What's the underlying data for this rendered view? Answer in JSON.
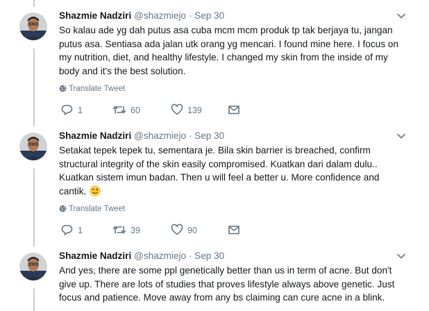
{
  "tweets": [
    {
      "name": "Shazmie Nadziri",
      "handle": "@shazmiejo",
      "separator": "·",
      "time": "Sep 30",
      "text": "So kalau ade yg dah putus asa cuba mcm mcm produk tp tak berjaya tu, jangan\nputus asa. Sentiasa ada jalan utk orang yg mencari. I found mine here. I focus on\nmy nutrition, diet, and healthy lifestyle. I changed my skin from the inside of my\nbody and it's the best solution.",
      "translate": "Translate Tweet",
      "replies": "1",
      "retweets": "60",
      "likes": "139"
    },
    {
      "name": "Shazmie Nadziri",
      "handle": "@shazmiejo",
      "separator": "·",
      "time": "Sep 30",
      "text": "Setakat tepek tepek tu, sementara je. Bila skin barrier is breached, confirm\nstructural integrity of the skin easily compromised. Kuatkan dari dalam dulu..\nKuatkan sistem imun badan. Then u will feel a better u. More confidence and\ncantik.",
      "emoji": "winking-face-emoji",
      "translate": "Translate Tweet",
      "replies": "1",
      "retweets": "39",
      "likes": "90"
    },
    {
      "name": "Shazmie Nadziri",
      "handle": "@shazmiejo",
      "separator": "·",
      "time": "Sep 30",
      "text": "And yes, there are some ppl genetically better than us in term of acne. But don't\ngive up. There are lots of studies that proves lifestyle always above genetic. Just\nfocus and patience. Move away from any bs claiming can cure acne in a blink."
    }
  ],
  "icons": {
    "reply": "reply-icon",
    "retweet": "retweet-icon",
    "like": "heart-icon",
    "message": "envelope-icon",
    "globe": "globe-icon",
    "caret": "chevron-down-icon"
  },
  "colors": {
    "text": "#14171a",
    "muted": "#657786",
    "thread_line": "#c4cfd6",
    "icon": "#657786"
  }
}
